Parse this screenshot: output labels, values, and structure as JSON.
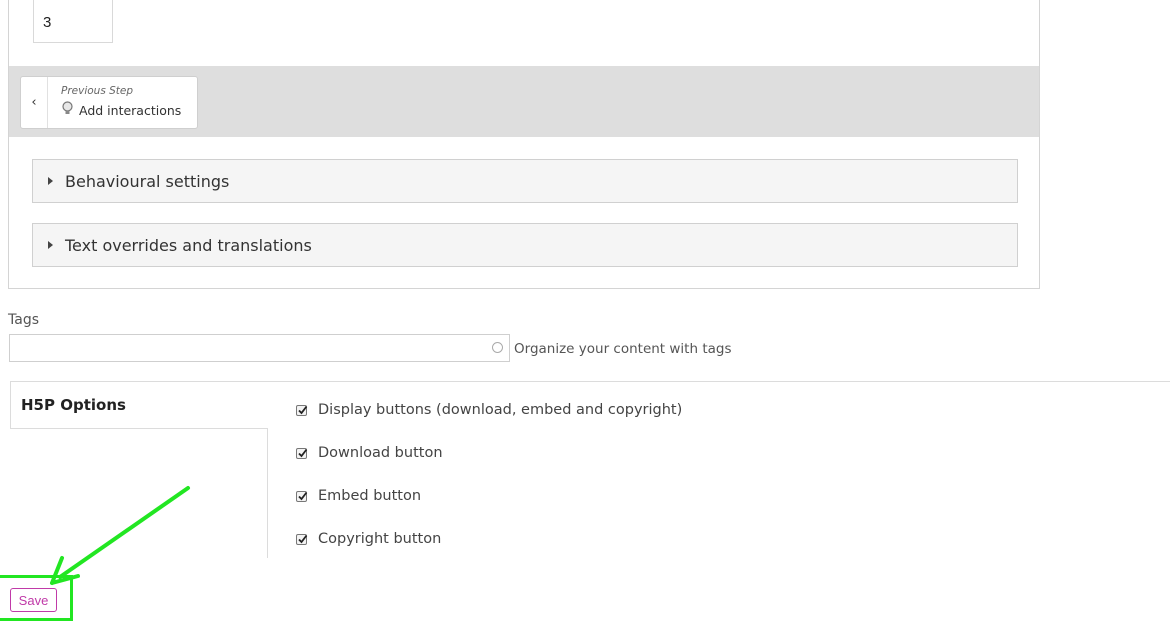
{
  "editor": {
    "number_value": "3",
    "previous_step": {
      "caption": "Previous Step",
      "label": "Add interactions"
    },
    "sections": [
      {
        "label": "Behavioural settings"
      },
      {
        "label": "Text overrides and translations"
      }
    ]
  },
  "tags": {
    "label": "Tags",
    "value": "",
    "hint": "Organize your content with tags"
  },
  "h5p_options": {
    "title": "H5P Options",
    "items": [
      {
        "label": "Display buttons (download, embed and copyright)",
        "checked": true
      },
      {
        "label": "Download button",
        "checked": true
      },
      {
        "label": "Embed button",
        "checked": true
      },
      {
        "label": "Copyright button",
        "checked": true
      }
    ]
  },
  "save_label": "Save",
  "colors": {
    "save_accent": "#c03aa8",
    "annotation_green": "#22e622"
  }
}
